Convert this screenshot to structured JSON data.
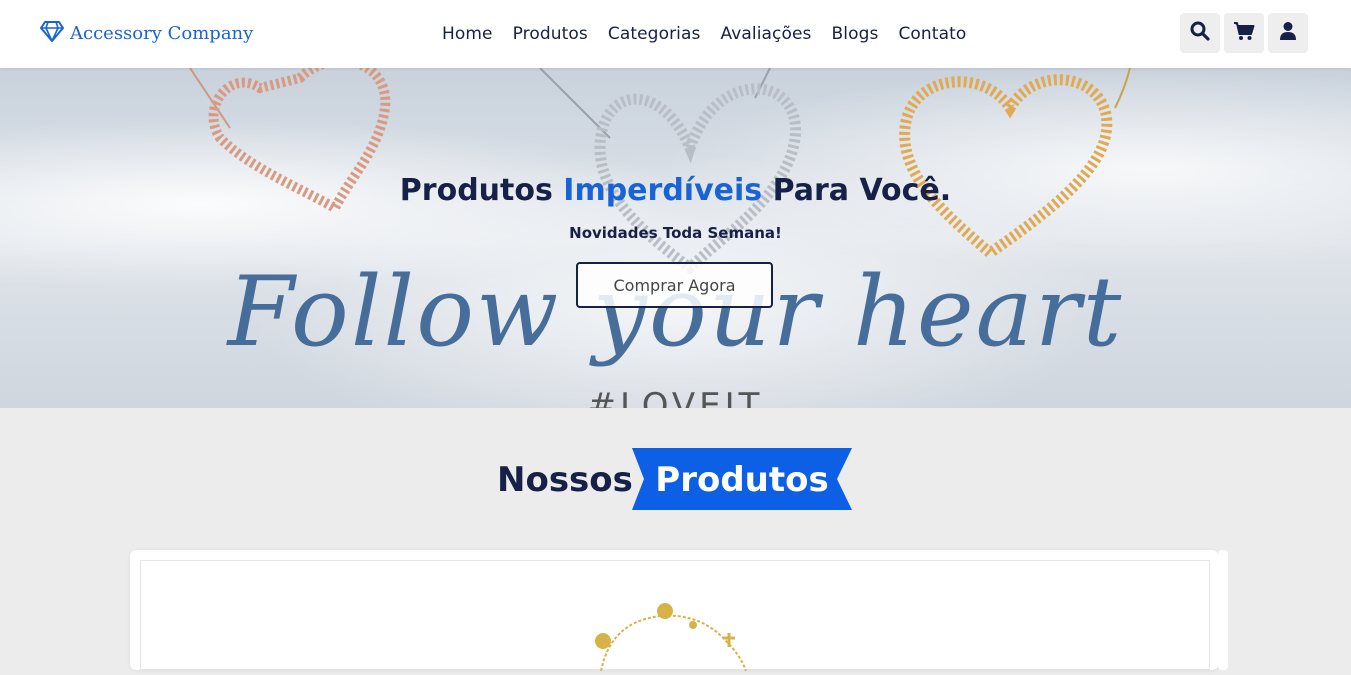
{
  "header": {
    "logo_text": "Accessory Company",
    "nav": [
      "Home",
      "Produtos",
      "Categorias",
      "Avaliações",
      "Blogs",
      "Contato"
    ],
    "icons": [
      "search-icon",
      "cart-icon",
      "user-icon"
    ]
  },
  "hero": {
    "title_part1": "Produtos ",
    "title_highlight": "Imperdíveis",
    "title_part2": " Para Você.",
    "subtitle": "Novidades Toda Semana!",
    "cta_label": "Comprar Agora",
    "script_text": "Follow your heart",
    "script_tag": "#LOVEIT"
  },
  "products_section": {
    "title_dark": "Nossos",
    "title_highlight": "Produtos"
  },
  "colors": {
    "brand_blue": "#1a63d6",
    "ribbon_blue": "#0d5fe6",
    "navy": "#172047",
    "page_bg": "#ececec"
  }
}
